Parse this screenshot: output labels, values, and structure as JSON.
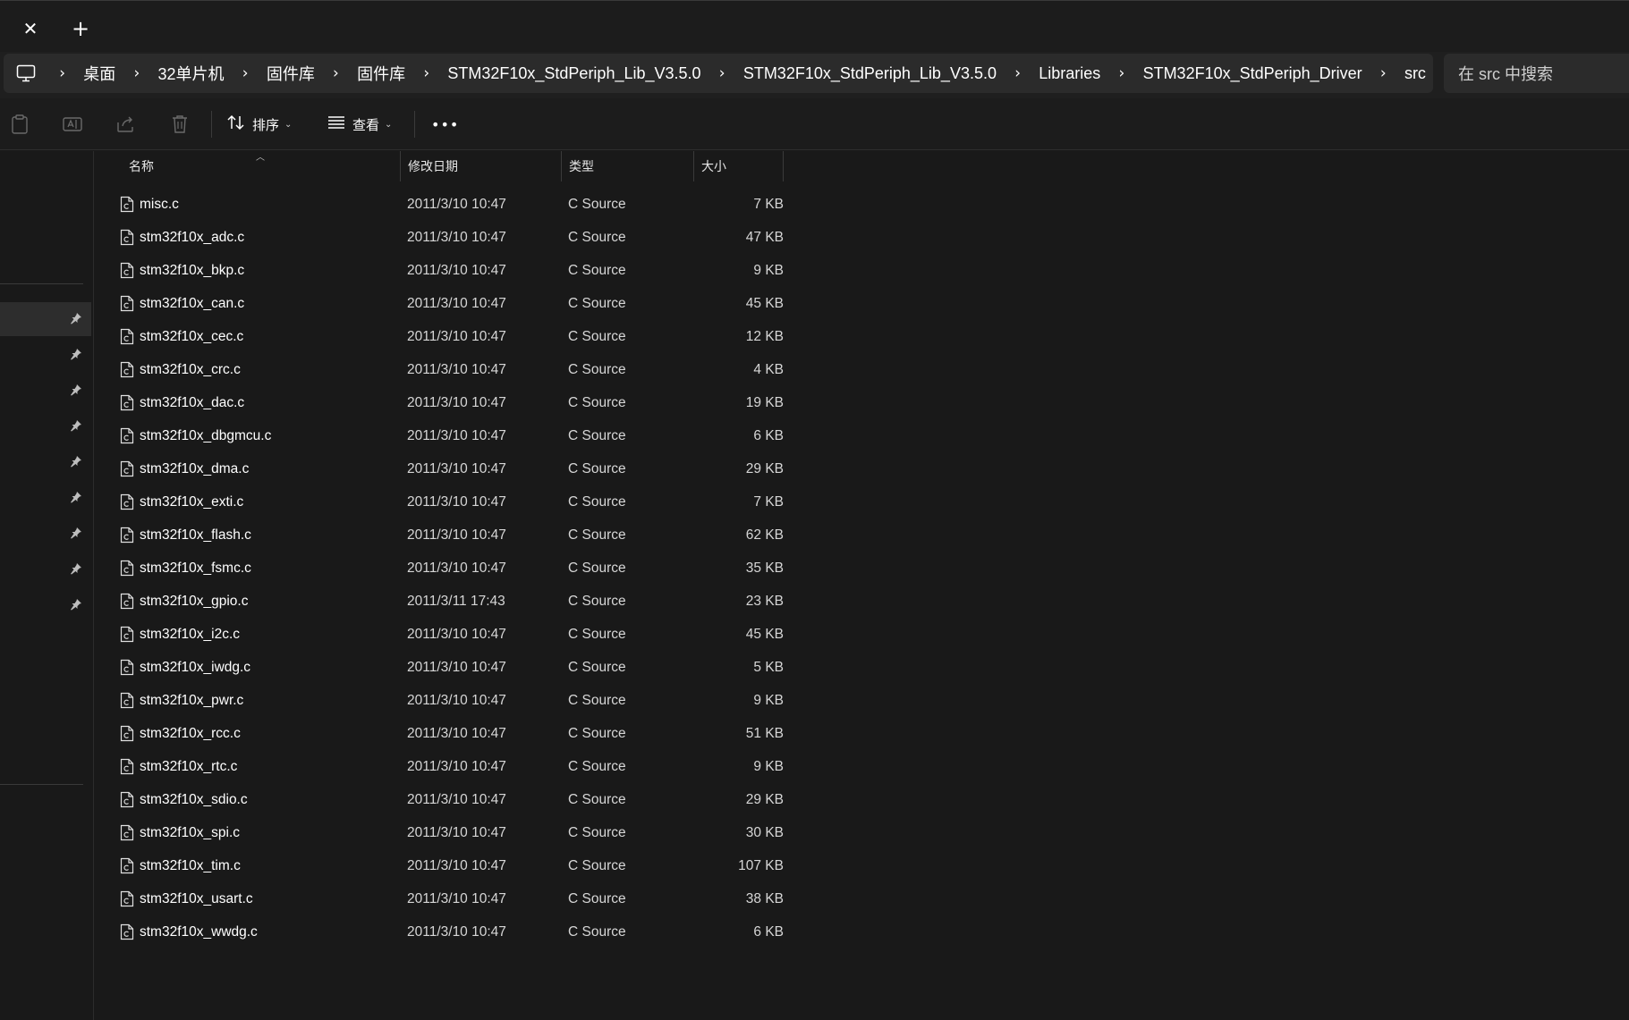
{
  "tabbar": {
    "close_glyph": "✕",
    "new_glyph": "+"
  },
  "address": {
    "icon": "computer-icon",
    "crumbs": [
      "桌面",
      "32单片机",
      "固件库",
      "固件库",
      "STM32F10x_StdPeriph_Lib_V3.5.0",
      "STM32F10x_StdPeriph_Lib_V3.5.0",
      "Libraries",
      "STM32F10x_StdPeriph_Driver",
      "src"
    ],
    "separator": "›",
    "search_placeholder": "在 src 中搜索"
  },
  "commandbar": {
    "icons": [
      "paste-icon",
      "rename-icon",
      "share-icon",
      "delete-icon"
    ],
    "sort_label": "排序",
    "view_label": "查看",
    "more_glyph": "•••"
  },
  "columns": {
    "name": "名称",
    "date": "修改日期",
    "type": "类型",
    "size": "大小"
  },
  "files": [
    {
      "name": "misc.c",
      "date": "2011/3/10 10:47",
      "type": "C Source",
      "size": "7 KB"
    },
    {
      "name": "stm32f10x_adc.c",
      "date": "2011/3/10 10:47",
      "type": "C Source",
      "size": "47 KB"
    },
    {
      "name": "stm32f10x_bkp.c",
      "date": "2011/3/10 10:47",
      "type": "C Source",
      "size": "9 KB"
    },
    {
      "name": "stm32f10x_can.c",
      "date": "2011/3/10 10:47",
      "type": "C Source",
      "size": "45 KB"
    },
    {
      "name": "stm32f10x_cec.c",
      "date": "2011/3/10 10:47",
      "type": "C Source",
      "size": "12 KB"
    },
    {
      "name": "stm32f10x_crc.c",
      "date": "2011/3/10 10:47",
      "type": "C Source",
      "size": "4 KB"
    },
    {
      "name": "stm32f10x_dac.c",
      "date": "2011/3/10 10:47",
      "type": "C Source",
      "size": "19 KB"
    },
    {
      "name": "stm32f10x_dbgmcu.c",
      "date": "2011/3/10 10:47",
      "type": "C Source",
      "size": "6 KB"
    },
    {
      "name": "stm32f10x_dma.c",
      "date": "2011/3/10 10:47",
      "type": "C Source",
      "size": "29 KB"
    },
    {
      "name": "stm32f10x_exti.c",
      "date": "2011/3/10 10:47",
      "type": "C Source",
      "size": "7 KB"
    },
    {
      "name": "stm32f10x_flash.c",
      "date": "2011/3/10 10:47",
      "type": "C Source",
      "size": "62 KB"
    },
    {
      "name": "stm32f10x_fsmc.c",
      "date": "2011/3/10 10:47",
      "type": "C Source",
      "size": "35 KB"
    },
    {
      "name": "stm32f10x_gpio.c",
      "date": "2011/3/11 17:43",
      "type": "C Source",
      "size": "23 KB"
    },
    {
      "name": "stm32f10x_i2c.c",
      "date": "2011/3/10 10:47",
      "type": "C Source",
      "size": "45 KB"
    },
    {
      "name": "stm32f10x_iwdg.c",
      "date": "2011/3/10 10:47",
      "type": "C Source",
      "size": "5 KB"
    },
    {
      "name": "stm32f10x_pwr.c",
      "date": "2011/3/10 10:47",
      "type": "C Source",
      "size": "9 KB"
    },
    {
      "name": "stm32f10x_rcc.c",
      "date": "2011/3/10 10:47",
      "type": "C Source",
      "size": "51 KB"
    },
    {
      "name": "stm32f10x_rtc.c",
      "date": "2011/3/10 10:47",
      "type": "C Source",
      "size": "9 KB"
    },
    {
      "name": "stm32f10x_sdio.c",
      "date": "2011/3/10 10:47",
      "type": "C Source",
      "size": "29 KB"
    },
    {
      "name": "stm32f10x_spi.c",
      "date": "2011/3/10 10:47",
      "type": "C Source",
      "size": "30 KB"
    },
    {
      "name": "stm32f10x_tim.c",
      "date": "2011/3/10 10:47",
      "type": "C Source",
      "size": "107 KB"
    },
    {
      "name": "stm32f10x_usart.c",
      "date": "2011/3/10 10:47",
      "type": "C Source",
      "size": "38 KB"
    },
    {
      "name": "stm32f10x_wwdg.c",
      "date": "2011/3/10 10:47",
      "type": "C Source",
      "size": "6 KB"
    }
  ],
  "nav": {
    "pinned_count": 9,
    "selected_index": 0,
    "pin_icon": "pin-icon"
  },
  "colors": {
    "background": "#191919",
    "bar": "#2b2b2b",
    "text": "#ffffff",
    "muted": "#d6d6d6"
  }
}
